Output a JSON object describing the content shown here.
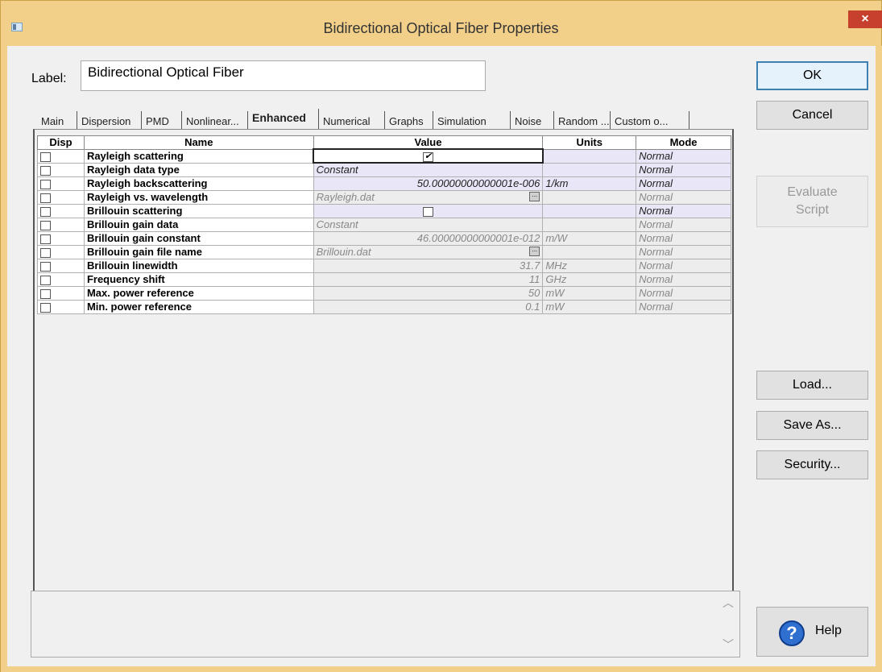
{
  "window": {
    "title": "Bidirectional Optical Fiber Properties",
    "close_label": "×"
  },
  "label_field": {
    "caption": "Label:",
    "value": "Bidirectional Optical Fiber"
  },
  "tabs": [
    {
      "label": "Main",
      "active": false
    },
    {
      "label": "Dispersion",
      "active": false
    },
    {
      "label": "PMD",
      "active": false
    },
    {
      "label": "Nonlinear...",
      "active": false
    },
    {
      "label": "Enhanced",
      "active": true
    },
    {
      "label": "Numerical",
      "active": false
    },
    {
      "label": "Graphs",
      "active": false
    },
    {
      "label": "Simulation",
      "active": false
    },
    {
      "label": "Noise",
      "active": false
    },
    {
      "label": "Random ...",
      "active": false
    },
    {
      "label": "Custom o...",
      "active": false
    }
  ],
  "grid": {
    "columns": [
      "Disp",
      "Name",
      "Value",
      "Units",
      "Mode"
    ],
    "rows": [
      {
        "name": "Rayleigh scattering",
        "value": "",
        "value_type": "checkbox",
        "checked": true,
        "units": "",
        "mode": "Normal",
        "editable": true
      },
      {
        "name": "Rayleigh data type",
        "value": "Constant",
        "value_type": "text",
        "units": "",
        "mode": "Normal",
        "editable": true
      },
      {
        "name": "Rayleigh backscattering",
        "value": "50.00000000000001e-006",
        "value_type": "number",
        "units": "1/km",
        "mode": "Normal",
        "editable": true
      },
      {
        "name": "Rayleigh vs. wavelength",
        "value": "Rayleigh.dat",
        "value_type": "file",
        "units": "",
        "mode": "Normal",
        "editable": false
      },
      {
        "name": "Brillouin scattering",
        "value": "",
        "value_type": "checkbox",
        "checked": false,
        "units": "",
        "mode": "Normal",
        "editable": true
      },
      {
        "name": "Brillouin gain data",
        "value": "Constant",
        "value_type": "text",
        "units": "",
        "mode": "Normal",
        "editable": false
      },
      {
        "name": "Brillouin gain constant",
        "value": "46.00000000000001e-012",
        "value_type": "number",
        "units": "m/W",
        "mode": "Normal",
        "editable": false
      },
      {
        "name": "Brillouin gain file name",
        "value": "Brillouin.dat",
        "value_type": "file",
        "units": "",
        "mode": "Normal",
        "editable": false
      },
      {
        "name": "Brillouin linewidth",
        "value": "31.7",
        "value_type": "number",
        "units": "MHz",
        "mode": "Normal",
        "editable": false
      },
      {
        "name": "Frequency shift",
        "value": "11",
        "value_type": "number",
        "units": "GHz",
        "mode": "Normal",
        "editable": false
      },
      {
        "name": "Max. power reference",
        "value": "50",
        "value_type": "number",
        "units": "mW",
        "mode": "Normal",
        "editable": false
      },
      {
        "name": "Min. power reference",
        "value": "0.1",
        "value_type": "number",
        "units": "mW",
        "mode": "Normal",
        "editable": false
      }
    ]
  },
  "buttons": {
    "ok": "OK",
    "cancel": "Cancel",
    "evaluate_line1": "Evaluate",
    "evaluate_line2": "Script",
    "load": "Load...",
    "save_as": "Save As...",
    "security": "Security...",
    "help": "Help"
  },
  "icons": {
    "app": "app-window-icon",
    "help": "help-question-icon",
    "browse": "ellipsis-browse-icon"
  },
  "colors": {
    "title_bar": "#f3d089",
    "close_button": "#c7402e",
    "editable_cell": "#e9e6f7",
    "readonly_cell": "#ededed",
    "help_icon": "#2f6fd0"
  }
}
